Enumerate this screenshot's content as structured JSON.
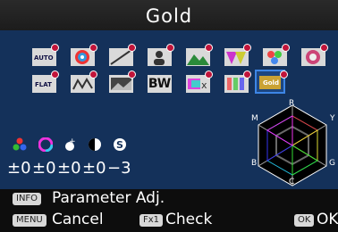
{
  "header": {
    "title": "Gold"
  },
  "presets": [
    {
      "name": "auto",
      "text": "AUTO"
    },
    {
      "name": "vivid",
      "text": ""
    },
    {
      "name": "natural",
      "text": ""
    },
    {
      "name": "portrait",
      "text": ""
    },
    {
      "name": "landscape",
      "text": ""
    },
    {
      "name": "radiant",
      "text": ""
    },
    {
      "name": "muted",
      "text": ""
    },
    {
      "name": "bleach",
      "text": ""
    },
    {
      "name": "flat",
      "text": "FLAT"
    },
    {
      "name": "reversal",
      "text": ""
    },
    {
      "name": "monotone",
      "text": ""
    },
    {
      "name": "bw",
      "text": "BW"
    },
    {
      "name": "cross",
      "text": ""
    },
    {
      "name": "retro",
      "text": ""
    },
    {
      "name": "gold",
      "text": "Gold"
    }
  ],
  "params": {
    "saturation": "±0",
    "hue": "±0",
    "highlight": "±0",
    "contrast": "±0",
    "sharpness": "−3"
  },
  "hex_labels": {
    "r": "R",
    "y": "Y",
    "g": "G",
    "c": "C",
    "b": "B",
    "m": "M"
  },
  "footer": {
    "info_btn": "INFO",
    "info_label": "Parameter Adj.",
    "menu_btn": "MENU",
    "menu_label": "Cancel",
    "fx_btn": "Fx1",
    "fx_label": "Check",
    "ok_btn": "OK",
    "ok_label": "OK"
  }
}
